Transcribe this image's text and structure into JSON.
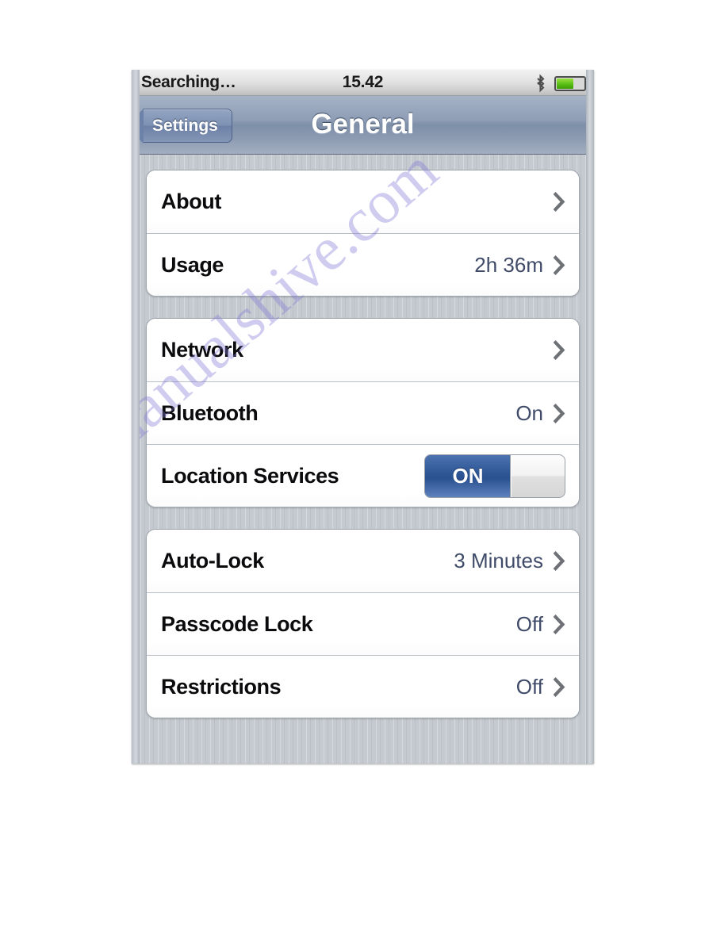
{
  "status_bar": {
    "carrier": "Searching…",
    "time": "15.42",
    "bluetooth_icon": "bluetooth-icon",
    "battery_icon": "battery-icon",
    "battery_level_percent": 58
  },
  "nav_bar": {
    "back_label": "Settings",
    "title": "General"
  },
  "groups": [
    {
      "rows": [
        {
          "label": "About",
          "value": "",
          "accessory": "chevron"
        },
        {
          "label": "Usage",
          "value": "2h 36m",
          "accessory": "chevron"
        }
      ]
    },
    {
      "rows": [
        {
          "label": "Network",
          "value": "",
          "accessory": "chevron"
        },
        {
          "label": "Bluetooth",
          "value": "On",
          "accessory": "chevron"
        },
        {
          "label": "Location Services",
          "value": "",
          "accessory": "toggle",
          "toggle_state": "ON"
        }
      ]
    },
    {
      "rows": [
        {
          "label": "Auto-Lock",
          "value": "3 Minutes",
          "accessory": "chevron"
        },
        {
          "label": "Passcode Lock",
          "value": "Off",
          "accessory": "chevron"
        },
        {
          "label": "Restrictions",
          "value": "Off",
          "accessory": "chevron"
        }
      ]
    }
  ],
  "watermark": {
    "text": "manualshive.com"
  },
  "colors": {
    "nav_bar_blue": "#8e9db5",
    "value_text": "#3f4b68",
    "toggle_on_blue": "#2d5694",
    "battery_green": "#55bb11",
    "background_gray": "#c5cad0"
  }
}
